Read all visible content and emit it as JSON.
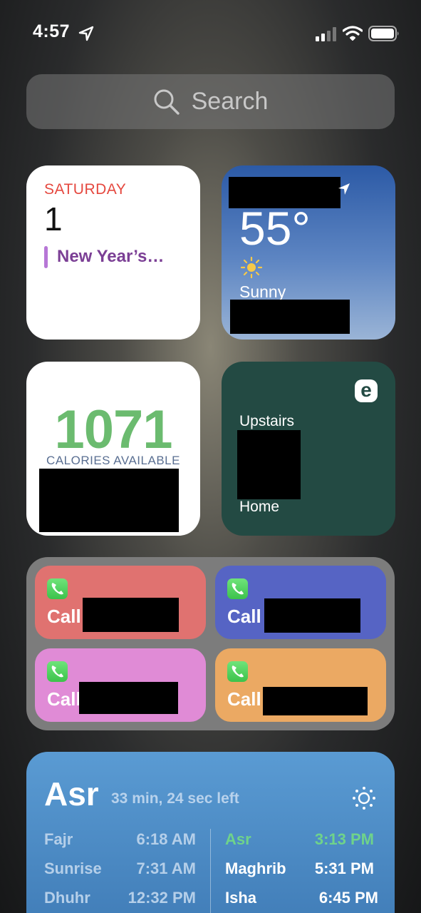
{
  "status_bar": {
    "time": "4:57"
  },
  "search": {
    "placeholder": "Search"
  },
  "calendar": {
    "day": "SATURDAY",
    "date": "1",
    "event": "New Year’s…",
    "event_color": "#b777d6"
  },
  "weather": {
    "temperature": "55°",
    "condition": "Sunny",
    "icon": "sun-icon"
  },
  "calories": {
    "value": "1071",
    "label": "CALORIES AVAILABLE",
    "color": "#6bbb6f"
  },
  "ecobee": {
    "logo": "e",
    "top_label": "Upstairs",
    "bottom_label": "Home"
  },
  "calls": [
    {
      "label": "Call",
      "color": "#e07270"
    },
    {
      "label": "Call",
      "color": "#5664c4"
    },
    {
      "label": "Call",
      "color": "#e08bd6"
    },
    {
      "label": "Call",
      "color": "#eba963"
    }
  ],
  "prayer": {
    "current": "Asr",
    "time_left": "33 min, 24 sec left",
    "left_column": [
      {
        "name": "Fajr",
        "time": "6:18 AM"
      },
      {
        "name": "Sunrise",
        "time": "7:31 AM"
      },
      {
        "name": "Dhuhr",
        "time": "12:32 PM"
      }
    ],
    "right_column": [
      {
        "name": "Asr",
        "time": "3:13 PM"
      },
      {
        "name": "Maghrib",
        "time": "5:31 PM"
      },
      {
        "name": "Isha",
        "time": "6:45 PM"
      }
    ]
  }
}
